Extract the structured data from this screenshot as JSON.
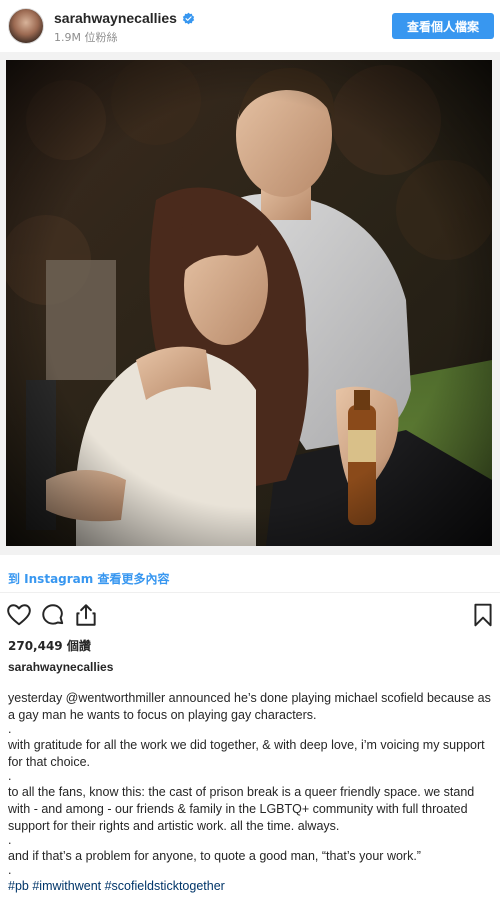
{
  "header": {
    "username": "sarahwaynecallies",
    "followers": "1.9M 位粉絲",
    "profile_button": "查看個人檔案"
  },
  "icons": {
    "verified": "verified-badge-icon",
    "like": "heart-icon",
    "comment": "comment-icon",
    "share": "share-icon",
    "save": "bookmark-icon"
  },
  "colors": {
    "accent": "#3897f0",
    "hashtag": "#003569",
    "text": "#262626",
    "muted": "#8e8e8e"
  },
  "photo": {
    "description_name": "post-photo"
  },
  "post": {
    "instagram_link": "到 Instagram 查看更多內容",
    "likes": "270,449 個讚",
    "caption_user": "sarahwaynecallies",
    "caption_lines": [
      "yesterday @wentworthmiller announced he’s done playing michael scofield because as a gay man he wants to focus on playing gay characters.",
      ".",
      "with gratitude for all the work we did together, & with deep love, i’m voicing my support for that choice.",
      ".",
      "to all the fans, know this: the cast of prison break is a queer friendly space. we stand with - and among - our friends & family in the LGBTQ+ community with full throated support for their rights and artistic work. all the time. always.",
      ".",
      "and if that’s a problem for anyone, to quote a good man, “that’s your work.”",
      "."
    ],
    "hashtags": [
      "#pb",
      "#imwithwent",
      "#scofieldsticktogether"
    ]
  }
}
